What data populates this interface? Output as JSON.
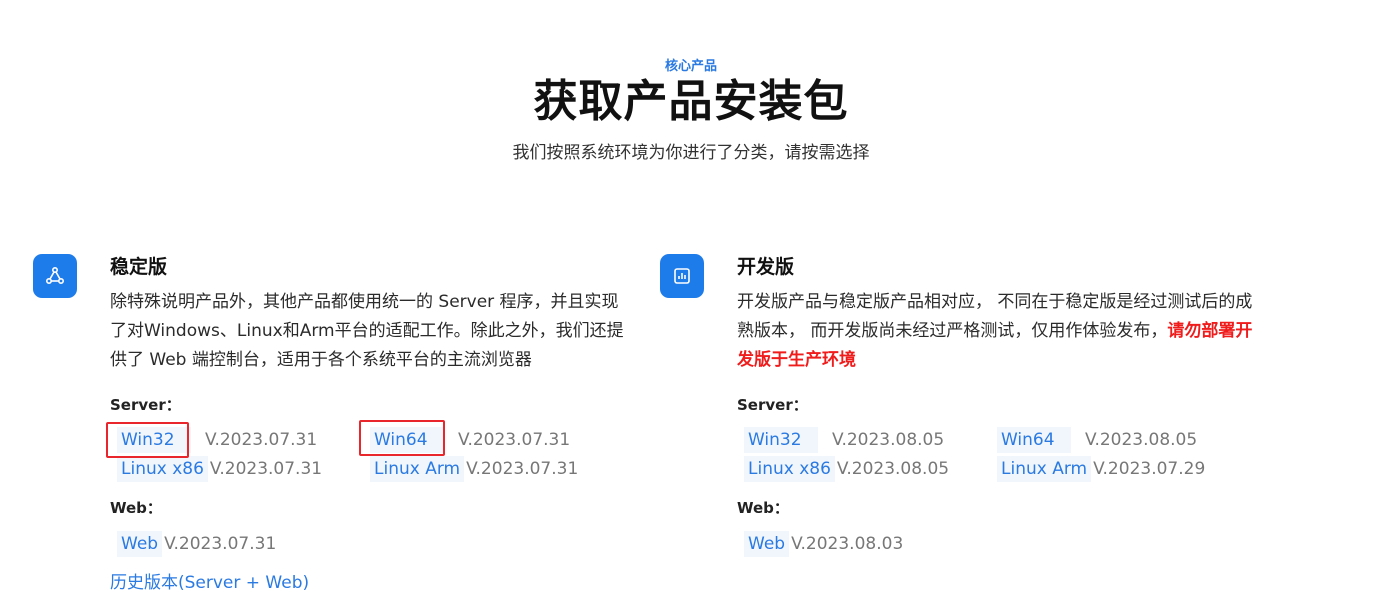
{
  "header": {
    "eyebrow": "核心产品",
    "title": "获取产品安装包",
    "subtitle": "我们按照系统环境为你进行了分类，请按需选择"
  },
  "stable": {
    "icon": "network-nodes-icon",
    "title": "稳定版",
    "description": "除特殊说明产品外，其他产品都使用统一的 Server 程序，并且实现了对Windows、Linux和Arm平台的适配工作。除此之外，我们还提供了 Web 端控制台，适用于各个系统平台的主流浏览器",
    "server_label": "Server：",
    "server": [
      {
        "name": "Win32",
        "version": "V.2023.07.31"
      },
      {
        "name": "Win64",
        "version": "V.2023.07.31"
      },
      {
        "name": "Linux x86",
        "version": "V.2023.07.31"
      },
      {
        "name": "Linux Arm",
        "version": "V.2023.07.31"
      }
    ],
    "web_label": "Web：",
    "web": {
      "name": "Web",
      "version": "V.2023.07.31"
    },
    "history": "历史版本(Server + Web)"
  },
  "dev": {
    "icon": "chart-icon",
    "title": "开发版",
    "description": "开发版产品与稳定版产品相对应， 不同在于稳定版是经过测试后的成熟版本， 而开发版尚未经过严格测试，仅用作体验发布，",
    "warning": "请勿部署开发版于生产环境",
    "server_label": "Server：",
    "server": [
      {
        "name": "Win32",
        "version": "V.2023.08.05"
      },
      {
        "name": "Win64",
        "version": "V.2023.08.05"
      },
      {
        "name": "Linux x86",
        "version": "V.2023.08.05"
      },
      {
        "name": "Linux Arm",
        "version": "V.2023.07.29"
      }
    ],
    "web_label": "Web：",
    "web": {
      "name": "Web",
      "version": "V.2023.08.03"
    }
  },
  "colors": {
    "accent": "#2a7ae2",
    "icon_bg": "#1e7bea",
    "warning": "#f01c1c",
    "highlight": "#e8262b"
  }
}
